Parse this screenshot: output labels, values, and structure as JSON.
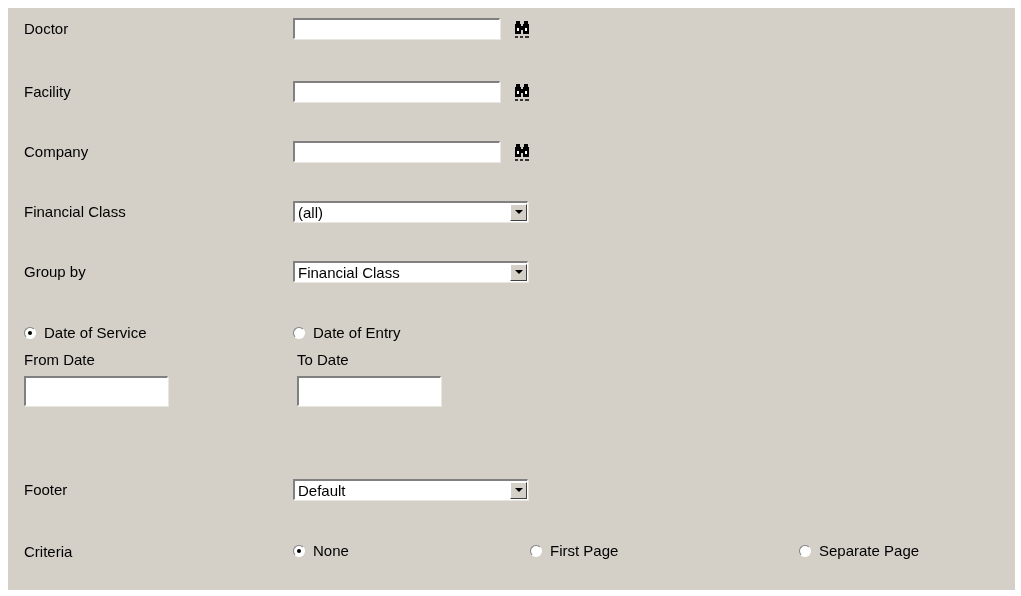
{
  "rows": [
    {
      "kind": "lookup",
      "label": "Doctor"
    },
    {
      "kind": "lookup",
      "label": "Facility"
    },
    {
      "kind": "lookup",
      "label": "Company"
    },
    {
      "kind": "select",
      "label": "Financial Class",
      "value": "(all)"
    },
    {
      "kind": "select",
      "label": "Group by",
      "value": "Financial Class"
    },
    {
      "kind": "radios",
      "options": [
        {
          "label": "Date of Service",
          "selected": true
        },
        {
          "label": "Date of Entry",
          "selected": false
        }
      ]
    },
    {
      "kind": "dates",
      "fields": [
        {
          "label": "From Date"
        },
        {
          "label": "To Date"
        }
      ]
    },
    {
      "kind": "select",
      "label": "Footer",
      "value": "Default"
    },
    {
      "kind": "radios",
      "label": "Criteria",
      "options": [
        {
          "label": "None",
          "selected": true
        },
        {
          "label": "First Page",
          "selected": false
        },
        {
          "label": "Separate Page",
          "selected": false
        }
      ]
    }
  ]
}
